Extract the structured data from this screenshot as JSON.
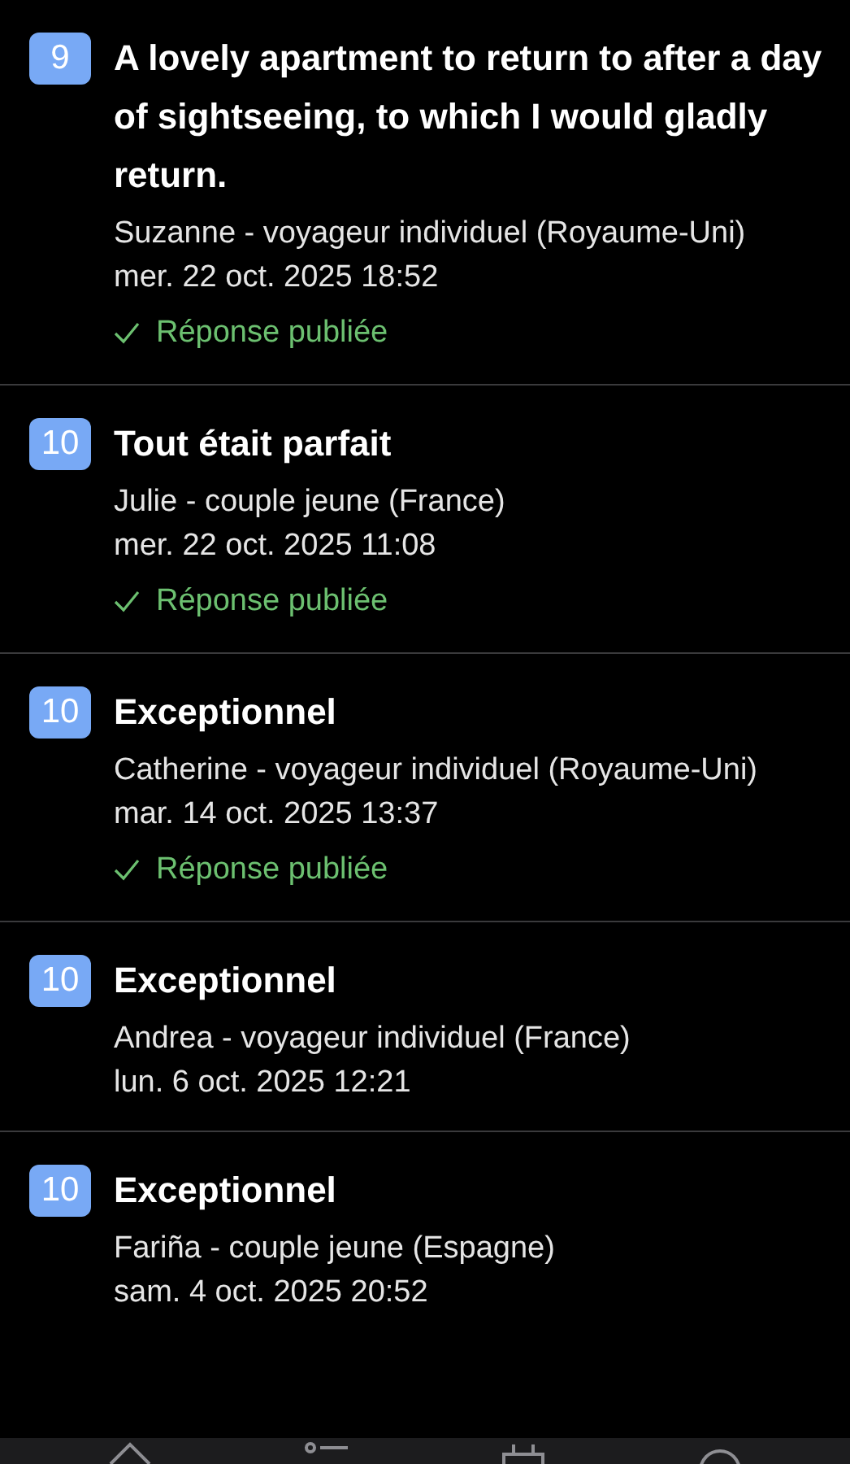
{
  "reviews": [
    {
      "score": "9",
      "title": "A lovely apartment to return to after a day of sightseeing, to which I would gladly return.",
      "author": "Suzanne - voyageur individuel (Royaume-Uni)",
      "date": "mer. 22 oct. 2025 18:52",
      "reply": "Réponse publiée"
    },
    {
      "score": "10",
      "title": "Tout était parfait",
      "author": "Julie - couple jeune (France)",
      "date": "mer. 22 oct. 2025 11:08",
      "reply": "Réponse publiée"
    },
    {
      "score": "10",
      "title": "Exceptionnel",
      "author": "Catherine - voyageur individuel (Royaume-Uni)",
      "date": "mar. 14 oct. 2025 13:37",
      "reply": "Réponse publiée"
    },
    {
      "score": "10",
      "title": "Exceptionnel",
      "author": "Andrea - voyageur individuel (France)",
      "date": "lun. 6 oct. 2025 12:21"
    },
    {
      "score": "10",
      "title": "Exceptionnel",
      "author": "Fariña - couple jeune (Espagne)",
      "date": "sam. 4 oct. 2025 20:52"
    }
  ]
}
